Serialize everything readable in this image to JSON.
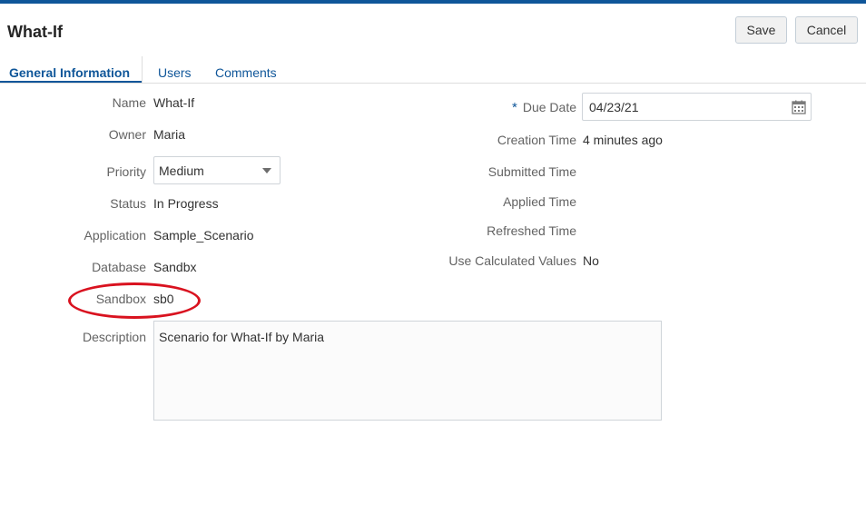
{
  "header": {
    "title": "What-If",
    "save_label": "Save",
    "cancel_label": "Cancel"
  },
  "tabs": [
    {
      "label": "General Information",
      "active": true
    },
    {
      "label": "Users",
      "active": false
    },
    {
      "label": "Comments",
      "active": false
    }
  ],
  "left_fields": {
    "name": {
      "label": "Name",
      "value": "What-If"
    },
    "owner": {
      "label": "Owner",
      "value": "Maria"
    },
    "priority": {
      "label": "Priority",
      "value": "Medium"
    },
    "status": {
      "label": "Status",
      "value": "In Progress"
    },
    "application": {
      "label": "Application",
      "value": "Sample_Scenario"
    },
    "database": {
      "label": "Database",
      "value": "Sandbx"
    },
    "sandbox": {
      "label": "Sandbox",
      "value": "sb0"
    },
    "description": {
      "label": "Description",
      "value": "Scenario for What-If by Maria"
    }
  },
  "right_fields": {
    "due_date": {
      "required_mark": "*",
      "label": "Due Date",
      "value": "04/23/21"
    },
    "creation_time": {
      "label": "Creation Time",
      "value": "4 minutes ago"
    },
    "submitted_time": {
      "label": "Submitted Time",
      "value": ""
    },
    "applied_time": {
      "label": "Applied Time",
      "value": ""
    },
    "refreshed_time": {
      "label": "Refreshed Time",
      "value": ""
    },
    "use_calculated_values": {
      "label": "Use Calculated Values",
      "value": "No"
    }
  },
  "colors": {
    "accent": "#0f5699",
    "highlight_circle": "#d9121f"
  },
  "icons": {
    "priority_dropdown": "chevron-down-icon",
    "due_date_picker": "calendar-icon"
  }
}
